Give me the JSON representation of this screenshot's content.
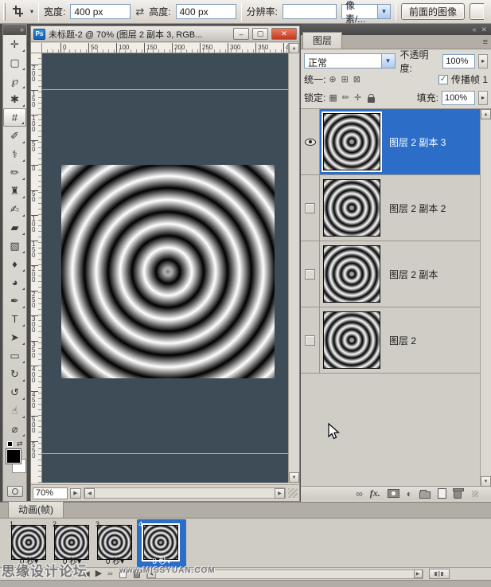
{
  "glyphs": {
    "up": "▲",
    "down": "▼",
    "left": "◀",
    "right": "▶",
    "menu": "≡",
    "dock_collapse": "«",
    "toolbox_expand": "»",
    "close": "✕",
    "minimize": "–",
    "maximize": "▢",
    "check": "✓",
    "dropdown": "▾",
    "slider_arrow": "▸",
    "swap": "⇄",
    "play": "▶",
    "first_frame": "|◀",
    "prev_frame": "◀",
    "link": "∞",
    "tween": "∞",
    "adjustment": "◐",
    "lock_transparent": "▦",
    "lock_paint": "✏",
    "lock_move": "✛",
    "unify_1": "⊕",
    "unify_2": "⊞",
    "unify_3": "⊠"
  },
  "options_bar": {
    "width_label": "宽度:",
    "width_value": "400 px",
    "height_label": "高度:",
    "height_value": "400 px",
    "resolution_label": "分辨率:",
    "resolution_value": "",
    "unit_value": "像素/...",
    "front_image_button": "前面的图像"
  },
  "toolbox": {
    "tools": [
      {
        "name": "move",
        "glyph": "✛"
      },
      {
        "name": "marquee",
        "glyph": "▢"
      },
      {
        "name": "lasso",
        "glyph": "℘"
      },
      {
        "name": "quick-selection",
        "glyph": "✱"
      },
      {
        "name": "crop",
        "glyph": "#",
        "cls": "selected"
      },
      {
        "name": "eyedropper",
        "glyph": "✐"
      },
      {
        "name": "healing-brush",
        "glyph": "⚕"
      },
      {
        "name": "brush",
        "glyph": "✏"
      },
      {
        "name": "clone-stamp",
        "glyph": "♜"
      },
      {
        "name": "history-brush",
        "glyph": "✍"
      },
      {
        "name": "eraser",
        "glyph": "▰"
      },
      {
        "name": "gradient",
        "glyph": "▧"
      },
      {
        "name": "blur",
        "glyph": "♦"
      },
      {
        "name": "dodge",
        "glyph": "◕"
      },
      {
        "name": "pen",
        "glyph": "✒"
      },
      {
        "name": "type",
        "glyph": "T"
      },
      {
        "name": "path-selection",
        "glyph": "➤"
      },
      {
        "name": "shape",
        "glyph": "▭"
      },
      {
        "name": "3d-rotate",
        "glyph": "↻"
      },
      {
        "name": "3d-orbit",
        "glyph": "↺"
      },
      {
        "name": "hand",
        "glyph": "☝"
      },
      {
        "name": "zoom",
        "glyph": "⌀"
      }
    ]
  },
  "document_window": {
    "ps_badge": "Ps",
    "title": "未标题-2 @ 70% (图层 2 副本 3, RGB...",
    "h_ruler": [
      "0",
      "50",
      "100",
      "150",
      "200",
      "250",
      "300",
      "350",
      "400"
    ],
    "v_ruler": [
      "200",
      "150",
      "100",
      "50",
      "0",
      "50",
      "100",
      "150",
      "200",
      "250",
      "300",
      "350",
      "400",
      "450",
      "500",
      "550"
    ],
    "zoom_level": "70%"
  },
  "layers_panel": {
    "tab": "图层",
    "blend_mode": "正常",
    "opacity_label": "不透明度:",
    "opacity_value": "100%",
    "unify_label": "统一:",
    "propagate_label": "传播帧 1",
    "lock_label": "锁定:",
    "fill_label": "填充:",
    "fill_value": "100%",
    "fx_label": "fx.",
    "layers": [
      {
        "name": "图层 2 副本 3"
      },
      {
        "name": "图层 2 副本 2"
      },
      {
        "name": "图层 2 副本"
      },
      {
        "name": "图层 2"
      }
    ]
  },
  "animation_panel": {
    "tab": "动画(帧)",
    "frames": [
      {
        "number": "1",
        "delay": "0 秒"
      },
      {
        "number": "2",
        "delay": "0 秒"
      },
      {
        "number": "3",
        "delay": "0 秒"
      },
      {
        "number": "4",
        "delay": "0 秒"
      }
    ]
  },
  "watermark": {
    "line1": "思缘设计论坛",
    "line2": "www.MISSYUAN.COM"
  },
  "colors": {
    "selection_blue": "#2b6dc7",
    "pasteboard": "#3e4c57",
    "guide_cyan": "#2ee3e6"
  }
}
